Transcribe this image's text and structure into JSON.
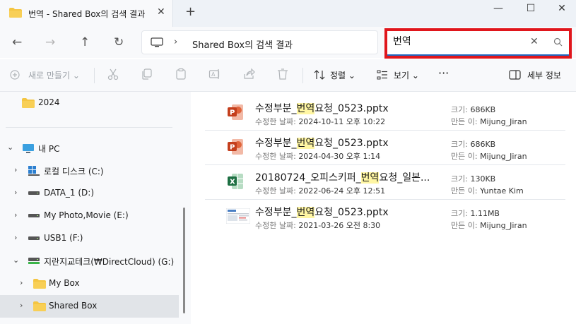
{
  "window": {
    "tab_title": "번역 - Shared Box의 검색 결과",
    "close_tab": "✕",
    "new_tab": "+",
    "minimize": "—",
    "maximize": "☐",
    "close": "✕"
  },
  "nav": {
    "back": "←",
    "forward": "→",
    "up": "↑",
    "refresh": "↻",
    "chevron": "›",
    "breadcrumb": "Shared Box의 검색 결과"
  },
  "search": {
    "value": "번역",
    "clear": "✕"
  },
  "toolbar": {
    "new_label": "새로 만들기",
    "sort_label": "정렬",
    "view_label": "보기",
    "more_label": "···",
    "details_label": "세부 정보"
  },
  "sidebar": {
    "items": [
      {
        "label": "2024"
      },
      {
        "label": "내 PC"
      },
      {
        "label": "로컬 디스크 (C:)"
      },
      {
        "label": "DATA_1 (D:)"
      },
      {
        "label": "My Photo,Movie (E:)"
      },
      {
        "label": "USB1 (F:)"
      },
      {
        "label": "지란지교테크(₩DirectCloud) (G:)"
      },
      {
        "label": "My Box"
      },
      {
        "label": "Shared Box"
      }
    ]
  },
  "results": {
    "modified_key": "수정한 날짜:",
    "size_key": "크기:",
    "author_key": "만든 이:",
    "items": [
      {
        "name_pre": "수정부분_",
        "name_hl": "번역",
        "name_post": "요청_0523.pptx",
        "modified": "2024-10-11 오후 10:22",
        "size": "686KB",
        "author": "Mijung_Jiran"
      },
      {
        "name_pre": "수정부분_",
        "name_hl": "번역",
        "name_post": "요청_0523.pptx",
        "modified": "2024-04-30 오후 1:14",
        "size": "686KB",
        "author": "Mijung_Jiran"
      },
      {
        "name_pre": "20180724_오피스키퍼_",
        "name_hl": "번역",
        "name_post": "요청_일본...",
        "modified": "2022-06-24 오후 12:51",
        "size": "130KB",
        "author": "Yuntae Kim"
      },
      {
        "name_pre": "수정부분_",
        "name_hl": "번역",
        "name_post": "요청_0523.pptx",
        "modified": "2021-03-26 오전 8:30",
        "size": "1.11MB",
        "author": "Mijung_Jiran"
      }
    ]
  },
  "colors": {
    "highlight": "#fff6a3",
    "search_outline": "#e0161c",
    "accent": "#1f66c1",
    "folder": "#f4c542",
    "ppt": "#c43e1c",
    "excel": "#1d6f42"
  },
  "icons": [
    "folder-icon",
    "computer-icon",
    "search-icon",
    "cut-icon",
    "copy-icon",
    "paste-icon",
    "rename-icon",
    "share-icon",
    "delete-icon",
    "sort-icon",
    "view-icon",
    "details-pane-icon",
    "drive-icon",
    "windows-drive-icon",
    "network-drive-icon",
    "powerpoint-file-icon",
    "excel-file-icon",
    "image-thumbnail-icon"
  ]
}
